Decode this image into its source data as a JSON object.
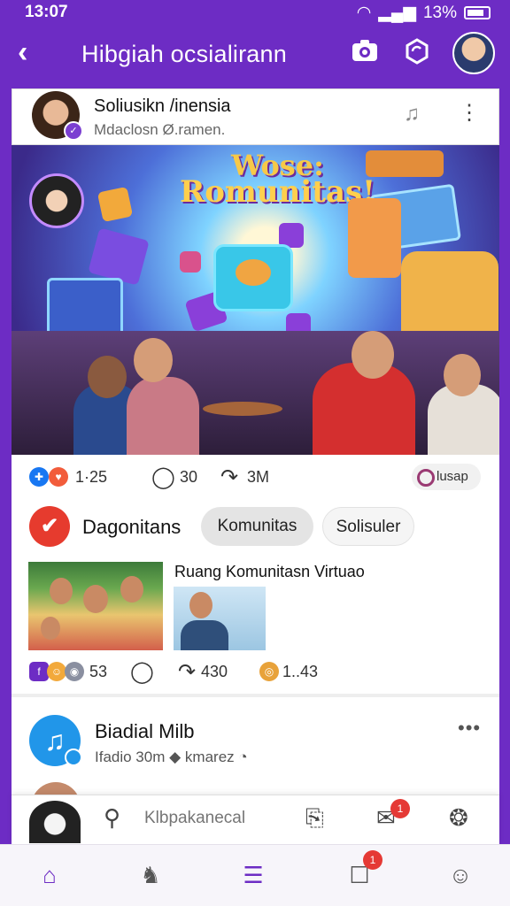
{
  "status": {
    "time": "13:07",
    "battery": "13%"
  },
  "header": {
    "title": "Hibgiah ocsialirann",
    "back_icon": "back-arrow-icon",
    "camera_icon": "camera-icon",
    "settings_icon": "hex-settings-icon"
  },
  "post1": {
    "author": "Soliusikn /inensia",
    "subtitle": "Mdaclosn Ø.ramen.",
    "hero_title_line1": "Wose:",
    "hero_title_line2": "Romunitas!",
    "reactions": {
      "like_count": "1·25",
      "comment_count": "30",
      "share_count": "3M",
      "pill_label": "lusap"
    }
  },
  "group": {
    "name": "Dagonitans",
    "chips": [
      {
        "label": "Komunitas",
        "active": true
      },
      {
        "label": "Solisuler",
        "active": false
      }
    ],
    "media_title": "Ruang Komunitasn Virtuao",
    "reactions": {
      "like_count": "53",
      "share_count": "430",
      "extra_count": "1..43"
    }
  },
  "post2": {
    "author": "Biadial Milb",
    "subtitle": "Ifadio 30m",
    "subtitle2": "kmarez"
  },
  "composer": {
    "placeholder": "Klbpakanecal",
    "notif_badge": "1"
  },
  "navbar": {
    "items": [
      {
        "icon": "home-icon",
        "active": true
      },
      {
        "icon": "chess-knight-icon",
        "active": false
      },
      {
        "icon": "menu-icon",
        "active": false
      },
      {
        "icon": "inbox-icon",
        "active": false,
        "badge": "1"
      },
      {
        "icon": "emoji-face-icon",
        "active": false
      }
    ]
  },
  "colors": {
    "brand": "#6d2cc4",
    "accent_red": "#e53935",
    "blue": "#2196e9"
  }
}
